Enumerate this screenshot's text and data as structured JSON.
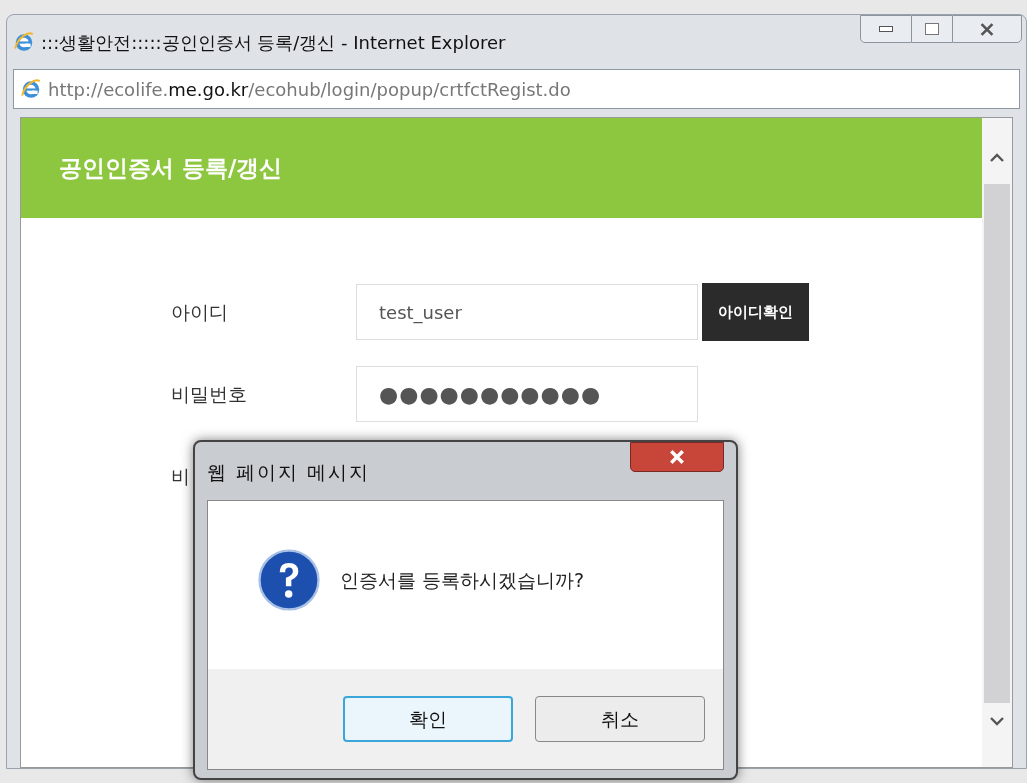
{
  "window": {
    "title": ":::생활안전:::::공인인증서 등록/갱신 - Internet Explorer"
  },
  "address_bar": {
    "url_parts": [
      {
        "text": "http://ecolife.",
        "emphasis": false
      },
      {
        "text": "me.go.kr",
        "emphasis": true
      },
      {
        "text": "/ecohub/login/popup/crtfctRegist.do",
        "emphasis": false
      }
    ]
  },
  "page": {
    "heading": "공인인증서 등록/갱신",
    "fields": [
      {
        "label": "아이디",
        "value": "test_user",
        "kind": "text",
        "button": "아이디확인"
      },
      {
        "label": "비밀번호",
        "value": "●●●●●●●●●●●",
        "kind": "password"
      },
      {
        "label": "비",
        "kind": "hidden"
      }
    ]
  },
  "dialog": {
    "title": "웹 페이지 메시지",
    "message": "인증서를 등록하시겠습니까?",
    "buttons": [
      {
        "label": "확인",
        "selected": true
      },
      {
        "label": "취소",
        "selected": false
      }
    ]
  }
}
